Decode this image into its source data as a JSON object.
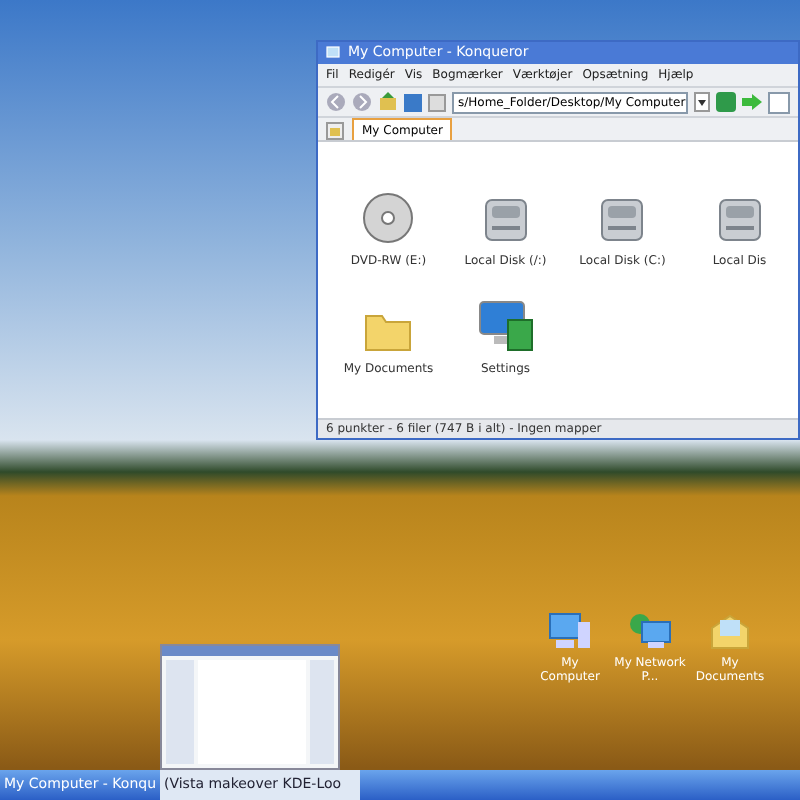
{
  "window": {
    "title": "My Computer - Konqueror",
    "menu": [
      "Fil",
      "Redigér",
      "Vis",
      "Bogmærker",
      "Værktøjer",
      "Opsætning",
      "Hjælp"
    ],
    "location": "s/Home_Folder/Desktop/My Computer",
    "tabs": [
      {
        "label": "My Computer",
        "selected": true
      }
    ],
    "items": [
      {
        "label": "DVD-RW (E:)",
        "kind": "dvd"
      },
      {
        "label": "Local Disk (/:)",
        "kind": "disk"
      },
      {
        "label": "Local Disk (C:)",
        "kind": "disk"
      },
      {
        "label": "Local Dis",
        "kind": "disk"
      },
      {
        "label": "My Documents",
        "kind": "folder"
      },
      {
        "label": "Settings",
        "kind": "settings"
      }
    ],
    "status": "6 punkter - 6 filer (747 B i alt) - Ingen mapper"
  },
  "desktop_icons": [
    {
      "label": "My Computer",
      "kind": "computer"
    },
    {
      "label": "My Network P...",
      "kind": "network"
    },
    {
      "label": "My Documents",
      "kind": "mail"
    }
  ],
  "taskbar": [
    {
      "label": "My Computer - Konqu",
      "selected": false
    },
    {
      "label": "(Vista makeover KDE-Loo",
      "selected": true
    }
  ]
}
